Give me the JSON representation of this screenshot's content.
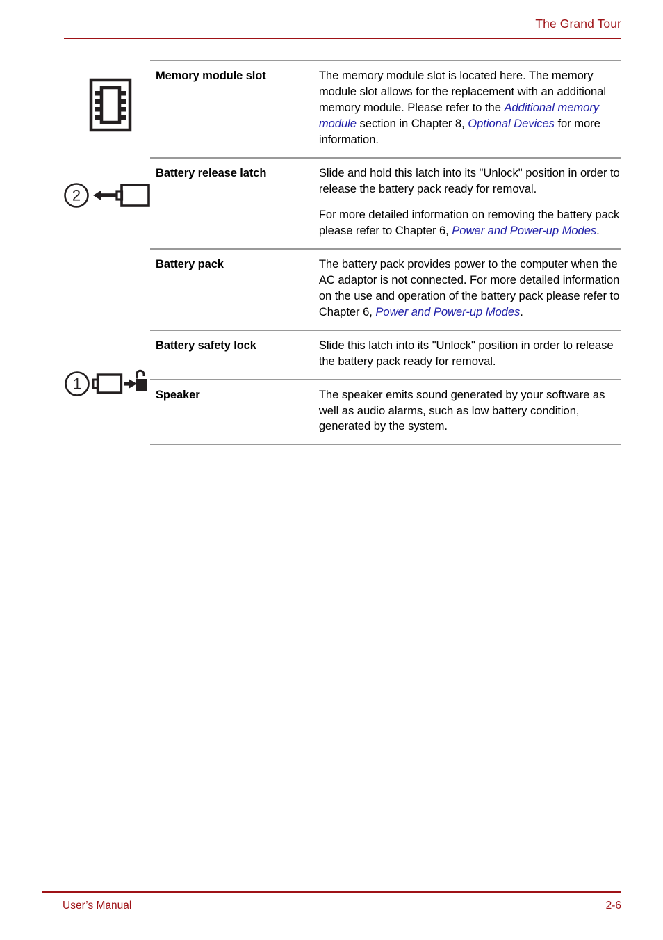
{
  "header": {
    "title": "The Grand Tour"
  },
  "footer": {
    "left_label": "User’s Manual",
    "page_number": "2-6"
  },
  "colors": {
    "accent_red": "#9e1216",
    "reference_blue": "#1f1fa8",
    "rule_gray": "#9a9a9a",
    "ink": "#000000"
  },
  "table": {
    "rows": [
      {
        "term": "Memory module slot",
        "icon": "memory-module-chip-icon",
        "callout": "",
        "paragraphs": [
          [
            {
              "t": "The memory module slot is located here. The memory module slot allows for the replacement with an additional memory module. Please refer to the ",
              "s": "plain"
            },
            {
              "t": "Additional memory module",
              "s": "ref"
            },
            {
              "t": " section in Chapter 8, ",
              "s": "plain"
            },
            {
              "t": "Optional Devices",
              "s": "ref"
            },
            {
              "t": " for more information.",
              "s": "plain"
            }
          ]
        ]
      },
      {
        "term": "Battery release latch",
        "icon": "battery-release-latch-icon",
        "callout": "2",
        "paragraphs": [
          [
            {
              "t": "Slide and hold this latch into its \"Unlock\" position in order to release the battery pack ready for removal.",
              "s": "plain"
            }
          ],
          [
            {
              "t": "For more detailed information on removing the battery pack please refer to Chapter 6, ",
              "s": "plain"
            },
            {
              "t": "Power and Power-up Modes",
              "s": "ref"
            },
            {
              "t": ".",
              "s": "plain"
            }
          ]
        ]
      },
      {
        "term": "Battery pack",
        "icon": "",
        "callout": "",
        "paragraphs": [
          [
            {
              "t": "The battery pack provides power to the computer when the AC adaptor is not connected. For more detailed information on the use and operation of the battery pack please refer to Chapter 6, ",
              "s": "plain"
            },
            {
              "t": "Power and Power-up Modes",
              "s": "ref"
            },
            {
              "t": ".",
              "s": "plain"
            }
          ]
        ]
      },
      {
        "term": "Battery safety lock",
        "icon": "battery-safety-lock-icon",
        "callout": "1",
        "paragraphs": [
          [
            {
              "t": "Slide this latch into its \"Unlock\" position in order to release the battery pack ready for removal.",
              "s": "plain"
            }
          ]
        ]
      },
      {
        "term": "Speaker",
        "icon": "",
        "callout": "",
        "paragraphs": [
          [
            {
              "t": "The speaker emits sound generated by your software as well as audio alarms, such as low battery condition, generated by the system.",
              "s": "plain"
            }
          ]
        ]
      }
    ]
  },
  "figures": {
    "memory_module": {
      "name": "memory-module-chip-icon",
      "callout": ""
    },
    "battery_release_latch": {
      "name": "battery-release-latch-icon",
      "callout": "2"
    },
    "battery_safety_lock": {
      "name": "battery-safety-lock-icon",
      "callout": "1"
    }
  }
}
